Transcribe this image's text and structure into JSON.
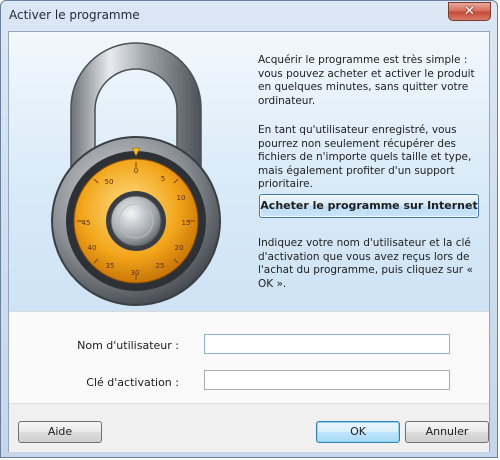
{
  "window": {
    "title": "Activer le programme",
    "close_glyph": "✕"
  },
  "intro": {
    "paragraph1": "Acquérir le programme est très simple : vous pouvez acheter et activer le produit en quelques minutes, sans quitter votre ordinateur.",
    "paragraph2": "En tant qu'utilisateur enregistré, vous pourrez non seulement récupérer des fichiers de n'importe quels taille et type, mais également profiter d'un support prioritaire.",
    "buy_button": "Acheter le programme sur Internet",
    "paragraph3": "Indiquez votre nom d'utilisateur et la clé d'activation que vous avez reçus lors de l'achat du programme, puis cliquez sur « OK »."
  },
  "padlock": {
    "dial_numbers": [
      "0",
      "5",
      "10",
      "15",
      "20",
      "25",
      "30",
      "35",
      "40",
      "45",
      "50"
    ]
  },
  "form": {
    "username_label": "Nom d'utilisateur :",
    "username_value": "",
    "key_label": "Clé d'activation :",
    "key_value": ""
  },
  "buttons": {
    "help": "Aide",
    "ok": "OK",
    "cancel": "Annuler"
  },
  "colors": {
    "accent": "#3c7fb1",
    "banner": "#d9eaf8",
    "dial": "#f2a51a"
  }
}
